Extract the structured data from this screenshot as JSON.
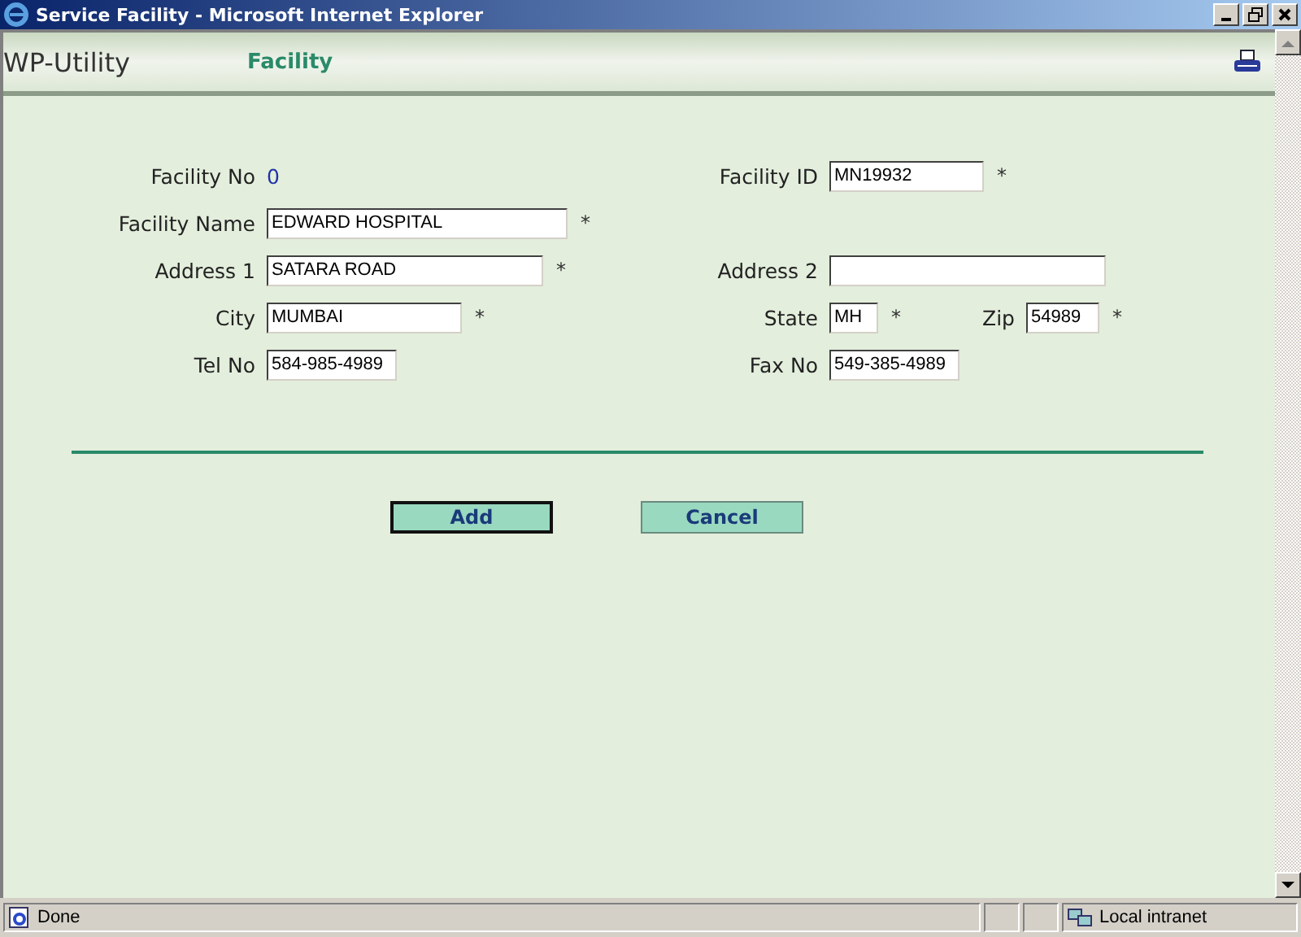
{
  "window": {
    "title": "Service Facility - Microsoft Internet Explorer"
  },
  "header": {
    "app_name": "WP-Utility",
    "page_title": "Facility"
  },
  "form_rows": [
    {
      "left": [
        {
          "kind": "static",
          "label": "Facility No",
          "value": "0",
          "required": false
        }
      ],
      "right": [
        {
          "kind": "input",
          "label": "Facility ID",
          "value": "MN19932",
          "required": true
        }
      ]
    },
    {
      "left": [
        {
          "kind": "input",
          "label": "Facility Name",
          "value": "EDWARD HOSPITAL",
          "required": true
        }
      ],
      "right": []
    },
    {
      "left": [
        {
          "kind": "input",
          "label": "Address 1",
          "value": "SATARA ROAD",
          "required": true
        }
      ],
      "right": [
        {
          "kind": "input",
          "label": "Address 2",
          "required": false
        }
      ]
    },
    {
      "left": [
        {
          "kind": "input",
          "label": "City",
          "value": "MUMBAI",
          "required": true
        }
      ],
      "right": [
        {
          "kind": "input",
          "label": "State",
          "value": "MH",
          "required": true
        },
        {
          "kind": "input",
          "label": "Zip",
          "value": "54989",
          "required": true
        }
      ]
    },
    {
      "left": [
        {
          "kind": "input",
          "label": "Tel No",
          "value": "584-985-4989",
          "required": false
        }
      ],
      "right": [
        {
          "kind": "input",
          "label": "Fax No",
          "value": "549-385-4989",
          "required": false
        }
      ]
    }
  ],
  "required_mark": "*",
  "buttons": [
    {
      "label": "Add",
      "selected": true
    },
    {
      "label": "Cancel",
      "selected": false
    }
  ],
  "status_bar": {
    "text": "Done",
    "zone": "Local intranet"
  }
}
